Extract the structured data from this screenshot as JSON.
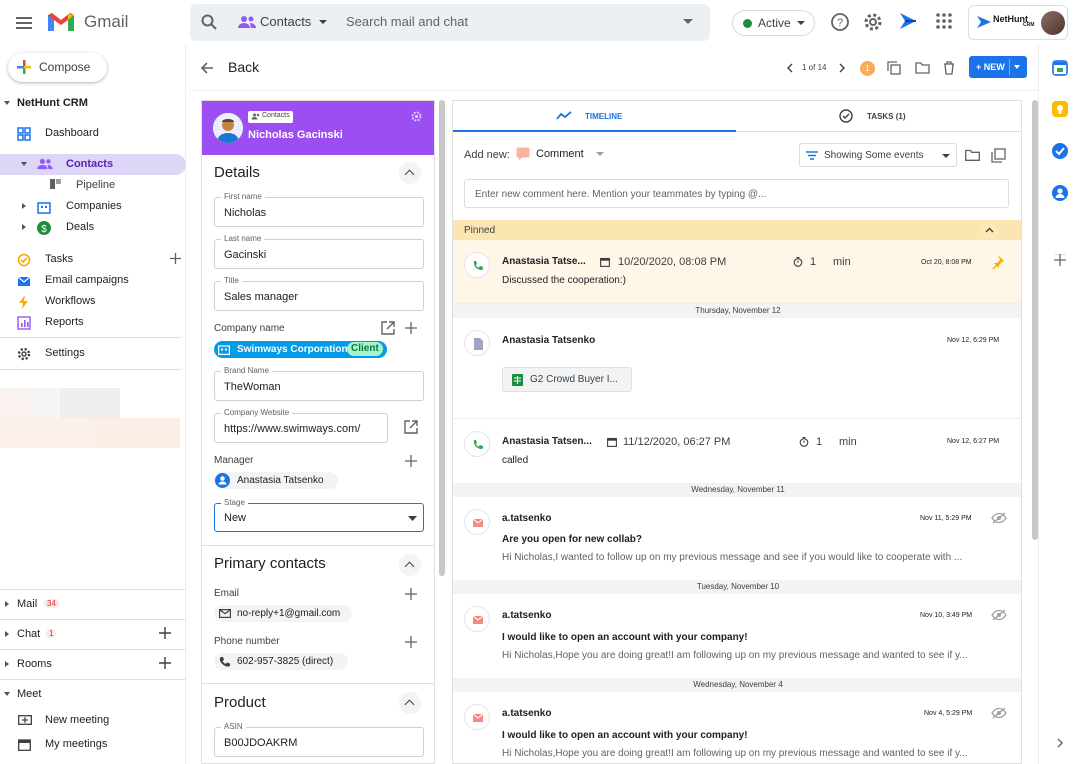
{
  "top": {
    "app_name": "Gmail",
    "search_chip": "Contacts",
    "search_placeholder": "Search mail and chat",
    "status": "Active",
    "account_brand": "NetHunt",
    "account_brand_sub": "CRM"
  },
  "sidebar": {
    "compose": "Compose",
    "section": "NetHunt CRM",
    "items": [
      {
        "label": "Dashboard",
        "icon": "dashboard-icon"
      },
      {
        "label": "Contacts",
        "icon": "contacts-icon"
      },
      {
        "label": "Pipeline",
        "icon": "pipeline-icon"
      },
      {
        "label": "Companies",
        "icon": "companies-icon"
      },
      {
        "label": "Deals",
        "icon": "deals-icon"
      },
      {
        "label": "Tasks",
        "icon": "tasks-icon"
      },
      {
        "label": "Email campaigns",
        "icon": "email-campaigns-icon"
      },
      {
        "label": "Workflows",
        "icon": "workflows-icon"
      },
      {
        "label": "Reports",
        "icon": "reports-icon"
      },
      {
        "label": "Settings",
        "icon": "settings-icon"
      }
    ],
    "mail": {
      "label": "Mail",
      "count": "34"
    },
    "chat": {
      "label": "Chat",
      "count": "1"
    },
    "rooms": {
      "label": "Rooms"
    },
    "meet": {
      "label": "Meet",
      "new_meeting": "New meeting",
      "my_meetings": "My meetings"
    }
  },
  "toolbar": {
    "back": "Back",
    "pager": "1 of 14",
    "badge": "1",
    "new_label": "+ NEW"
  },
  "card": {
    "chip": "Contacts",
    "name": "Nicholas Gacinski",
    "details_title": "Details",
    "first_name": {
      "label": "First name",
      "value": "Nicholas"
    },
    "last_name": {
      "label": "Last name",
      "value": "Gacinski"
    },
    "title": {
      "label": "Title",
      "value": "Sales manager"
    },
    "company_label": "Company name",
    "company": "Swimways Corporation",
    "company_tag": "Client",
    "brand": {
      "label": "Brand Name",
      "value": "TheWoman"
    },
    "website": {
      "label": "Company Website",
      "value": "https://www.swimways.com/"
    },
    "manager_label": "Manager",
    "manager": "Anastasia Tatsenko",
    "stage": {
      "label": "Stage",
      "value": "New"
    },
    "primary_title": "Primary contacts",
    "email_label": "Email",
    "email": "no-reply+1@gmail.com",
    "phone_label": "Phone number",
    "phone": "602-957-3825 (direct)",
    "product_title": "Product",
    "asin": {
      "label": "ASIN",
      "value": "B00JDOAKRM"
    }
  },
  "timeline": {
    "tab_timeline": "TIMELINE",
    "tab_tasks": "TASKS (1)",
    "add_new": "Add new:",
    "comment": "Comment",
    "filter": "Showing Some events",
    "comment_placeholder": "Enter new comment here. Mention your teammates by typing @...",
    "pinned": "Pinned",
    "events": [
      {
        "who": "Anastasia Tatse...",
        "date": "10/20/2020, 08:08 PM",
        "dur": "1",
        "unit": "min",
        "time": "Oct 20, 8:08 PM",
        "body": "Discussed the cooperation:)"
      },
      {
        "sep": "Thursday, November 12"
      },
      {
        "who": "Anastasia Tatsenko",
        "time": "Nov 12, 6:29 PM",
        "attachment": "G2 Crowd Buyer I..."
      },
      {
        "who": "Anastasia Tatsen...",
        "date": "11/12/2020, 06:27 PM",
        "dur": "1",
        "unit": "min",
        "time": "Nov 12, 6:27 PM",
        "body": "called"
      },
      {
        "sep": "Wednesday, November 11"
      },
      {
        "who": "a.tatsenko",
        "time": "Nov 11, 5:29 PM",
        "subject": "Are you open for new collab?",
        "snippet": "Hi Nicholas,I wanted to follow up on my previous message and see if you would like to cooperate with ..."
      },
      {
        "sep": "Tuesday, November 10"
      },
      {
        "who": "a.tatsenko",
        "time": "Nov 10, 3:49 PM",
        "subject": "I would like to open an account with your company!",
        "snippet": "Hi Nicholas,Hope you are doing great!I am following up on my previous message and wanted to see if y..."
      },
      {
        "sep": "Wednesday, November 4"
      },
      {
        "who": "a.tatsenko",
        "time": "Nov 4, 5:29 PM",
        "subject": "I would like to open an account with your company!",
        "snippet": "Hi Nicholas,Hope you are doing great!I am following up on my previous message and wanted to see if y..."
      }
    ]
  },
  "colors": {
    "accent": "#1a73e8",
    "header": "#9d4ef2",
    "pinned": "#fbe6b2"
  }
}
